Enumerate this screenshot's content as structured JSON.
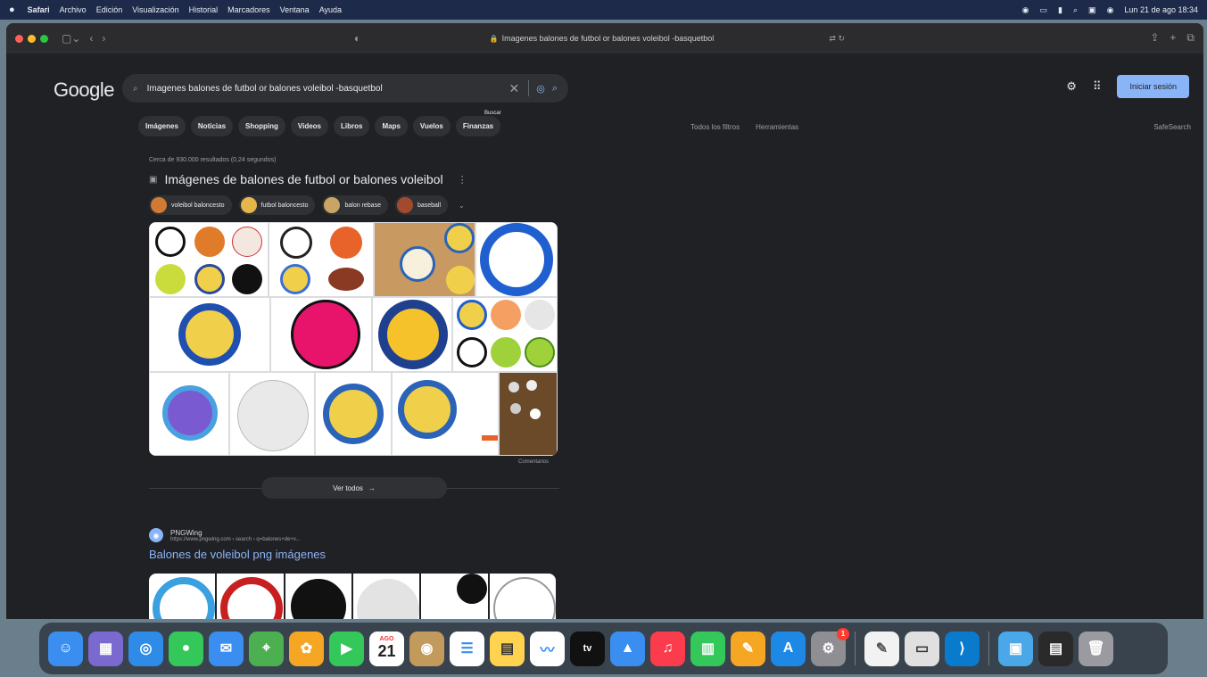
{
  "menubar": {
    "items": [
      "Safari",
      "Archivo",
      "Edición",
      "Visualización",
      "Historial",
      "Marcadores",
      "Ventana",
      "Ayuda"
    ],
    "clock": "Lun 21 de ago 18:34"
  },
  "browser": {
    "address": "Imagenes balones de futbol or balones voleibol -basquetbol"
  },
  "google": {
    "logo": "Google",
    "query": "Imagenes balones de futbol or balones voleibol -basquetbol",
    "signin": "Iniciar sesión",
    "tabs": [
      "Imágenes",
      "Noticias",
      "Shopping",
      "Videos",
      "Libros",
      "Maps",
      "Vuelos",
      "Finanzas"
    ],
    "tab_more": "Buscar",
    "filters": [
      "Todos los filtros",
      "Herramientas"
    ],
    "safesearch": "SafeSearch"
  },
  "results": {
    "stats": "Cerca de 930.000 resultados (0,24 segundos)",
    "images_title": "Imágenes de balones de futbol or balones voleibol",
    "chips": [
      "voleibol baloncesto",
      "futbol baloncesto",
      "balon rebase",
      "baseball"
    ],
    "comment": "Comentarios",
    "see_all": "Ver todos"
  },
  "site": {
    "name": "PNGWing",
    "url": "https://www.pngwing.com › search › q=balones+de+v...",
    "title": "Balones de voleibol png imágenes"
  },
  "dock": {
    "calendar_day": "21",
    "calendar_month": "AGO",
    "tv_label": "tv",
    "settings_badge": "1"
  }
}
